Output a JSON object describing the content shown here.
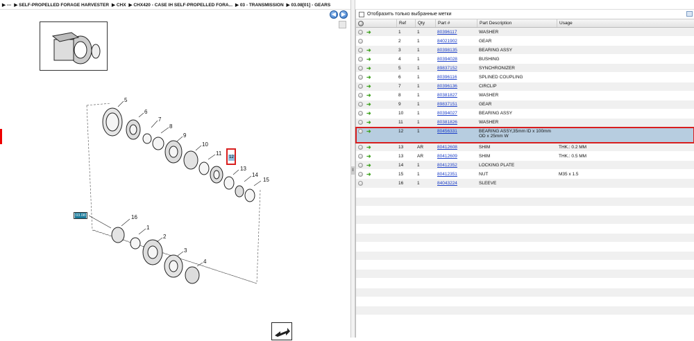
{
  "breadcrumb": {
    "items": [
      "▶ ---",
      "▶ SELF-PROPELLED FORAGE HARVESTER",
      "▶ CHX",
      "▶ CHX420 - CASE IH SELF-PROPELLED FORA...",
      "▶ 03 - TRANSMISSION",
      "▶ 03.08[01] - GEARS"
    ]
  },
  "nav": {
    "back_icon": "left-arrow-circle-icon",
    "forward_icon": "right-arrow-circle-icon"
  },
  "diagram": {
    "labels": [
      "5",
      "6",
      "7",
      "8",
      "9",
      "10",
      "11",
      "12",
      "13",
      "14",
      "15",
      "16",
      "1",
      "2",
      "3",
      "4"
    ],
    "selected_callout": "12",
    "reference_badge": "03.08"
  },
  "filter": {
    "label": "Отобразить только выбранные метки",
    "checked": false
  },
  "table": {
    "headers": {
      "ref": "Ref",
      "qty": "Qty",
      "part": "Part #",
      "desc": "Part Description",
      "usage": "Usage"
    },
    "rows": [
      {
        "ref": "1",
        "qty": "1",
        "part": "80396117",
        "desc": "WASHER",
        "usage": "",
        "arrow": true
      },
      {
        "ref": "2",
        "qty": "1",
        "part": "84021902",
        "desc": "GEAR",
        "usage": "",
        "arrow": false
      },
      {
        "ref": "3",
        "qty": "1",
        "part": "80398135",
        "desc": "BEARING ASSY",
        "usage": "",
        "arrow": true
      },
      {
        "ref": "4",
        "qty": "1",
        "part": "80394028",
        "desc": "BUSHING",
        "usage": "",
        "arrow": true
      },
      {
        "ref": "5",
        "qty": "1",
        "part": "89837152",
        "desc": "SYNCHRONIZER",
        "usage": "",
        "arrow": true
      },
      {
        "ref": "6",
        "qty": "1",
        "part": "80396116",
        "desc": "SPLINED COUPLING",
        "usage": "",
        "arrow": true
      },
      {
        "ref": "7",
        "qty": "1",
        "part": "80396136",
        "desc": "CIRCLIP",
        "usage": "",
        "arrow": true
      },
      {
        "ref": "8",
        "qty": "1",
        "part": "80381827",
        "desc": "WASHER",
        "usage": "",
        "arrow": true
      },
      {
        "ref": "9",
        "qty": "1",
        "part": "89837151",
        "desc": "GEAR",
        "usage": "",
        "arrow": true
      },
      {
        "ref": "10",
        "qty": "1",
        "part": "80394027",
        "desc": "BEARING ASSY",
        "usage": "",
        "arrow": true
      },
      {
        "ref": "11",
        "qty": "1",
        "part": "80381826",
        "desc": "WASHER",
        "usage": "",
        "arrow": true
      },
      {
        "ref": "12",
        "qty": "1",
        "part": "80456331",
        "desc": "BEARING ASSY,35mm ID x 100mm OD x 25mm W",
        "usage": "",
        "arrow": true,
        "selected": true
      },
      {
        "ref": "13",
        "qty": "AR",
        "part": "80412608",
        "desc": "SHIM",
        "usage": "THK.: 0.2 MM",
        "arrow": true
      },
      {
        "ref": "13",
        "qty": "AR",
        "part": "80412609",
        "desc": "SHIM",
        "usage": "THK.: 0.5 MM",
        "arrow": true
      },
      {
        "ref": "14",
        "qty": "1",
        "part": "80412352",
        "desc": "LOCKING PLATE",
        "usage": "",
        "arrow": true
      },
      {
        "ref": "15",
        "qty": "1",
        "part": "80412351",
        "desc": "NUT",
        "usage": "M35 x 1.5",
        "arrow": true
      },
      {
        "ref": "16",
        "qty": "1",
        "part": "84043224",
        "desc": "SLEEVE",
        "usage": "",
        "arrow": false
      }
    ]
  },
  "colors": {
    "selected_row": "#b7cde0",
    "highlight_border": "#d81e1e",
    "link": "#1a3dc8",
    "cart_arrow": "#3fa21f"
  }
}
